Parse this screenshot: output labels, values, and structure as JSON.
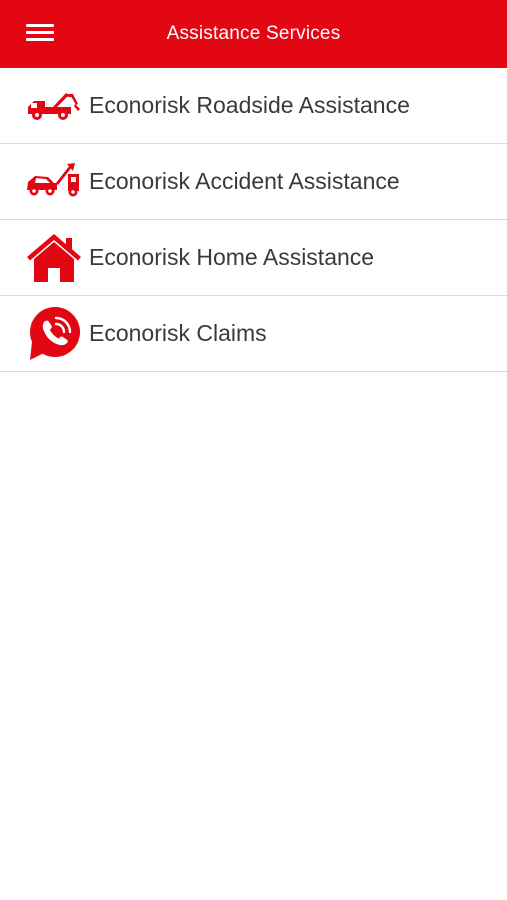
{
  "header": {
    "title": "Assistance Services",
    "menu_icon": "hamburger-menu-icon"
  },
  "colors": {
    "brand_red": "#e30613",
    "text": "#3a3a3a",
    "divider": "#dcdcdc"
  },
  "services": [
    {
      "label": "Econorisk Roadside Assistance",
      "icon": "tow-truck-icon"
    },
    {
      "label": "Econorisk Accident Assistance",
      "icon": "car-accident-tow-icon"
    },
    {
      "label": "Econorisk Home Assistance",
      "icon": "house-icon"
    },
    {
      "label": "Econorisk Claims",
      "icon": "phone-chat-bubble-icon"
    }
  ]
}
